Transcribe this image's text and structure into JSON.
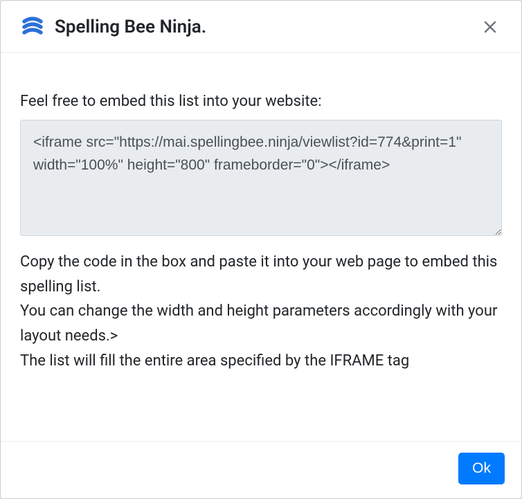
{
  "modal": {
    "title": "Spelling Bee Ninja.",
    "intro": "Feel free to embed this list into your website:",
    "code": "<iframe src=\"https://mai.spellingbee.ninja/viewlist?id=774&print=1\" width=\"100%\" height=\"800\" frameborder=\"0\"></iframe>",
    "instructions": "Copy the code in the box and paste it into your web page to embed this spelling list.\nYou can change the width and height parameters accordingly with your layout needs.>\nThe list will fill the entire area specified by the IFRAME tag",
    "ok_label": "Ok"
  }
}
